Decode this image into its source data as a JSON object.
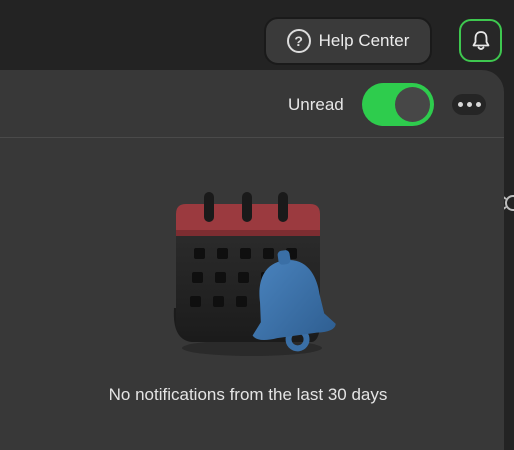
{
  "header": {
    "help_center_label": "Help Center",
    "help_icon_glyph": "?"
  },
  "panel": {
    "unread_label": "Unread",
    "unread_toggle_on": true,
    "empty_message": "No notifications from the last 30 days"
  },
  "colors": {
    "accent_green": "#2ecc4d",
    "calendar_red": "#9b3a3f",
    "bell_blue": "#3a6fa6"
  },
  "icons": {
    "help": "question-circle-icon",
    "bell": "bell-icon",
    "more": "more-horizontal-icon",
    "illustration": "calendar-bell-illustration"
  }
}
